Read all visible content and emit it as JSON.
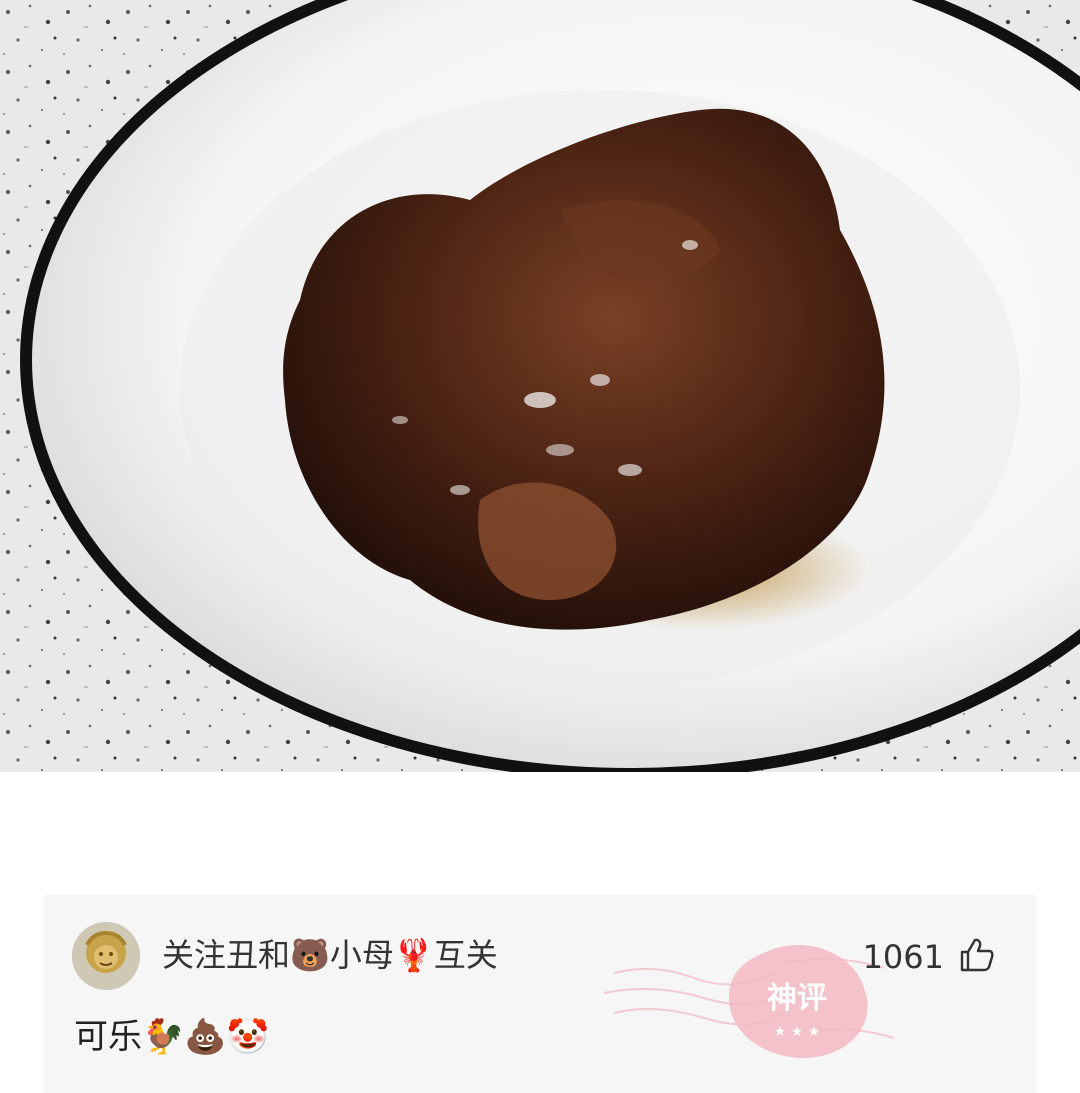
{
  "comment_card": {
    "username": "关注丑和🐻小母🦞互关",
    "like_count": "1061",
    "comment_text": "可乐🐓💩🤡",
    "badge_text": "神评"
  },
  "icons": {
    "like": "thumbs-up-icon",
    "badge": "stamp-icon"
  },
  "colors": {
    "card_background": "#f6f6f6",
    "badge_pink": "#f2b8c2",
    "sauce_brown": "#4a2414"
  }
}
